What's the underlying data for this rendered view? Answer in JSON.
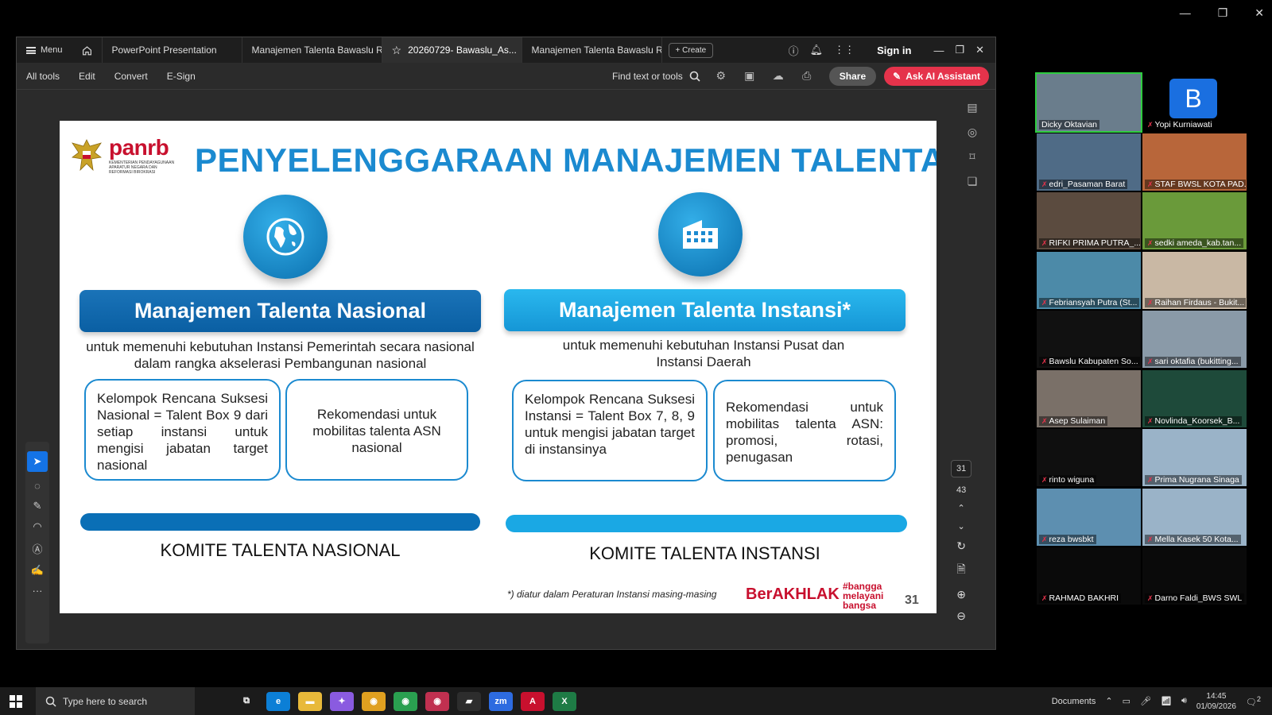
{
  "zoom_window": {
    "minimize": "—",
    "maximize": "❐",
    "close": "✕"
  },
  "acrobat": {
    "menu_label": "Menu",
    "tabs": [
      {
        "label": "PowerPoint Presentation"
      },
      {
        "label": "Manajemen Talenta Bawaslu RI..."
      },
      {
        "label": "20260729- Bawaslu_As..."
      },
      {
        "label": "Manajemen Talenta Bawaslu RI..."
      }
    ],
    "create_label": "Create",
    "sign_in": "Sign in",
    "toolbar": {
      "all_tools": "All tools",
      "edit": "Edit",
      "convert": "Convert",
      "esign": "E-Sign",
      "find": "Find text or tools",
      "share": "Share",
      "ask_ai": "Ask AI Assistant"
    },
    "page_current": "31",
    "page_total": "43"
  },
  "slide": {
    "brand": "panrb",
    "brand_sub": "KEMENTERIAN PENDAYAGUNAAN APARATUR NEGARA DAN REFORMASI BIROKRASI",
    "title": "PENYELENGGARAAN MANAJEMEN TALENTA",
    "left": {
      "heading": "Manajemen Talenta Nasional",
      "desc": "untuk memenuhi kebutuhan Instansi Pemerintah secara nasional dalam rangka akselerasi Pembangunan nasional",
      "box1": "Kelompok Rencana Suksesi Nasional = Talent Box 9 dari setiap instansi untuk mengisi jabatan target nasional",
      "box2": "Rekomendasi untuk mobilitas talenta ASN nasional",
      "komite": "KOMITE TALENTA NASIONAL"
    },
    "right": {
      "heading": "Manajemen Talenta Instansi*",
      "desc": "untuk memenuhi kebutuhan Instansi Pusat dan Instansi Daerah",
      "box1": "Kelompok Rencana Suksesi Instansi = Talent Box 7, 8, 9 untuk mengisi jabatan target di instansinya",
      "box2": "Rekomendasi untuk mobilitas talenta ASN: promosi, rotasi, penugasan",
      "komite": "KOMITE TALENTA INSTANSI"
    },
    "footnote": "*) diatur dalam Peraturan Instansi masing-masing",
    "berakhlak": "BerAKHLAK",
    "bangga": [
      "#bangga",
      "melayani",
      "bangsa"
    ],
    "page_number": "31",
    "colors": {
      "blue": "#1b8ad0",
      "dark_blue": "#0a5fa3",
      "light_blue": "#22aee6",
      "red": "#c8102e"
    }
  },
  "participants": [
    {
      "name": "Dicky Oktavian",
      "bg": "#6a7d8c",
      "muted": false
    },
    {
      "name": "Yopi Kurniawati",
      "bg": "#000000",
      "muted": true,
      "initial": "B"
    },
    {
      "name": "edri_Pasaman Barat",
      "bg": "#4f6b86",
      "muted": true
    },
    {
      "name": "STAF BWSL KOTA PAD...",
      "bg": "#b8663a",
      "muted": true
    },
    {
      "name": "RIFKI PRIMA PUTRA_...",
      "bg": "#5b4b3f",
      "muted": true
    },
    {
      "name": "sedki ameda_kab.tan...",
      "bg": "#6a9a3a",
      "muted": true
    },
    {
      "name": "Febriansyah Putra (St...",
      "bg": "#4c8aa8",
      "muted": true
    },
    {
      "name": "Raihan Firdaus - Bukit...",
      "bg": "#c9b8a4",
      "muted": true
    },
    {
      "name": "Bawslu Kabupaten So...",
      "bg": "#111111",
      "muted": true
    },
    {
      "name": "sari oktafia (bukitting...",
      "bg": "#8a9aa8",
      "muted": true
    },
    {
      "name": "Asep Sulaiman",
      "bg": "#7a7068",
      "muted": true
    },
    {
      "name": "Novlinda_Koorsek_B...",
      "bg": "#1e4a3a",
      "muted": true
    },
    {
      "name": "rinto wiguna",
      "bg": "#0f0f0f",
      "muted": true
    },
    {
      "name": "Prima Nugrana Sinaga",
      "bg": "#9ab3c8",
      "muted": true
    },
    {
      "name": "reza bwsbkt",
      "bg": "#5d8fb0",
      "muted": true
    },
    {
      "name": "Mella Kasek 50 Kota...",
      "bg": "#9ab3c8",
      "muted": true
    },
    {
      "name": "RAHMAD BAKHRI",
      "bg": "#0a0a0a",
      "muted": true
    },
    {
      "name": "Darno Faldi_BWS SWL",
      "bg": "#0a0a0a",
      "muted": true
    }
  ],
  "taskbar": {
    "search_placeholder": "Type here to search",
    "documents": "Documents",
    "time": "14:45",
    "date": "01/09/2026",
    "notif_count": "2",
    "apps": [
      {
        "name": "task-view",
        "bg": "transparent",
        "label": "⧉"
      },
      {
        "name": "edge",
        "bg": "#0c7fd6",
        "label": "e"
      },
      {
        "name": "file-explorer",
        "bg": "#e8b93a",
        "label": "▬"
      },
      {
        "name": "copilot",
        "bg": "#8a5be0",
        "label": "✦"
      },
      {
        "name": "chrome",
        "bg": "#e0a020",
        "label": "◉"
      },
      {
        "name": "chrome-profile-2",
        "bg": "#2aa050",
        "label": "◉"
      },
      {
        "name": "chrome-profile-3",
        "bg": "#c03050",
        "label": "◉"
      },
      {
        "name": "sticky-notes",
        "bg": "#2d2d2d",
        "label": "▰"
      },
      {
        "name": "zoom",
        "bg": "#2d6be0",
        "label": "zm"
      },
      {
        "name": "acrobat",
        "bg": "#c8102e",
        "label": "A"
      },
      {
        "name": "excel",
        "bg": "#1e7b45",
        "label": "X"
      }
    ]
  }
}
